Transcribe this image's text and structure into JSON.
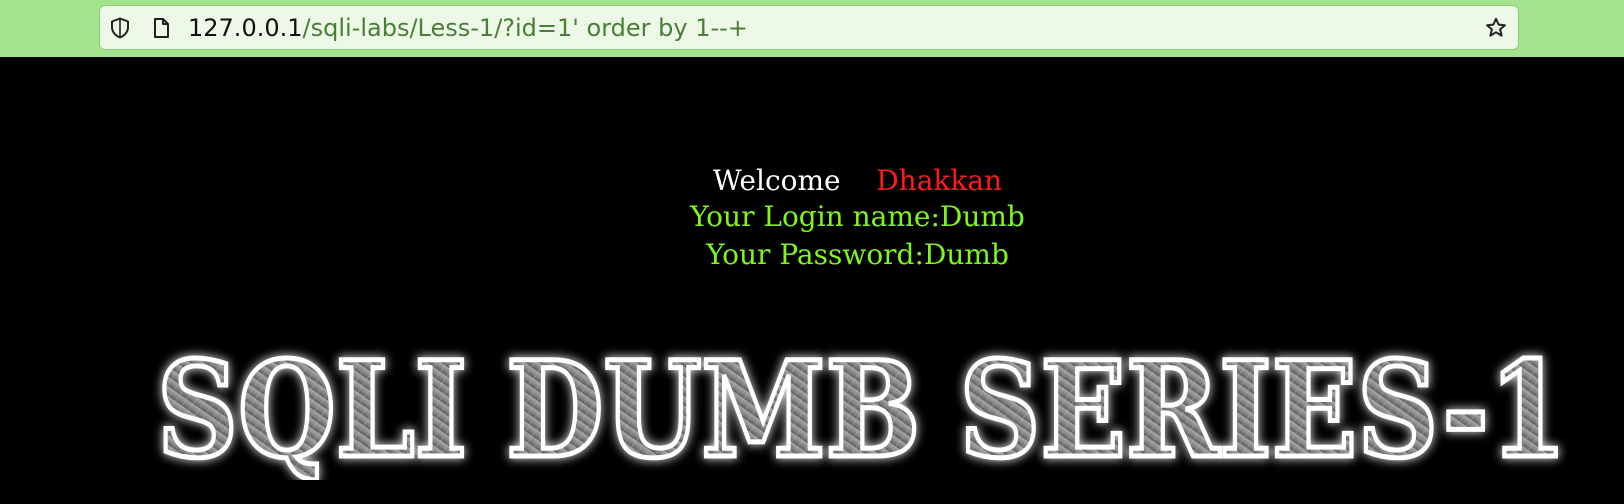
{
  "browser": {
    "url_host": "127.0.0.1",
    "url_path": "/sqli-labs/Less-1/?id=1' order by 1--+",
    "icons": [
      "shield-icon",
      "page-icon",
      "star-icon"
    ]
  },
  "page": {
    "welcome_label": "Welcome",
    "welcome_name": "Dhakkan",
    "login_line": "Your Login name:Dumb",
    "password_line": "Your Password:Dumb",
    "banner_text": "SQLI DUMB SERIES-1"
  },
  "colors": {
    "toolbar": "#a3e48c",
    "background": "#000000",
    "welcome": "#ffffff",
    "name": "#ff1a1a",
    "credentials": "#7ff51a"
  }
}
